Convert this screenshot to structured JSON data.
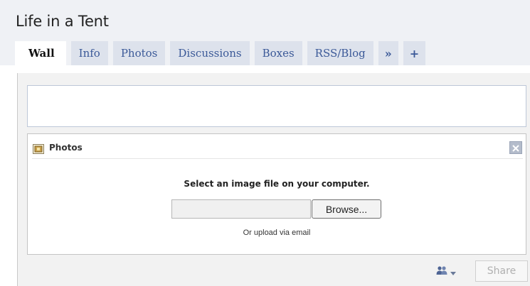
{
  "page": {
    "title": "Life in a Tent"
  },
  "tabs": [
    {
      "label": "Wall",
      "active": true
    },
    {
      "label": "Info"
    },
    {
      "label": "Photos"
    },
    {
      "label": "Discussions"
    },
    {
      "label": "Boxes"
    },
    {
      "label": "RSS/Blog"
    }
  ],
  "tab_icons": {
    "more": "»",
    "add": "+"
  },
  "status": {
    "value": ""
  },
  "attach_panel": {
    "title": "Photos",
    "icon": "photos-icon",
    "instructions": "Select an image file on your computer.",
    "file_value": "",
    "browse_label": "Browse...",
    "email_link": "Or upload via email"
  },
  "footer": {
    "privacy_icon": "people-icon",
    "share_label": "Share"
  },
  "colors": {
    "header_bg": "#eff1f5",
    "tab_bg": "#dde2ec",
    "link_blue": "#3b5998",
    "content_bg": "#f2f2f2"
  }
}
